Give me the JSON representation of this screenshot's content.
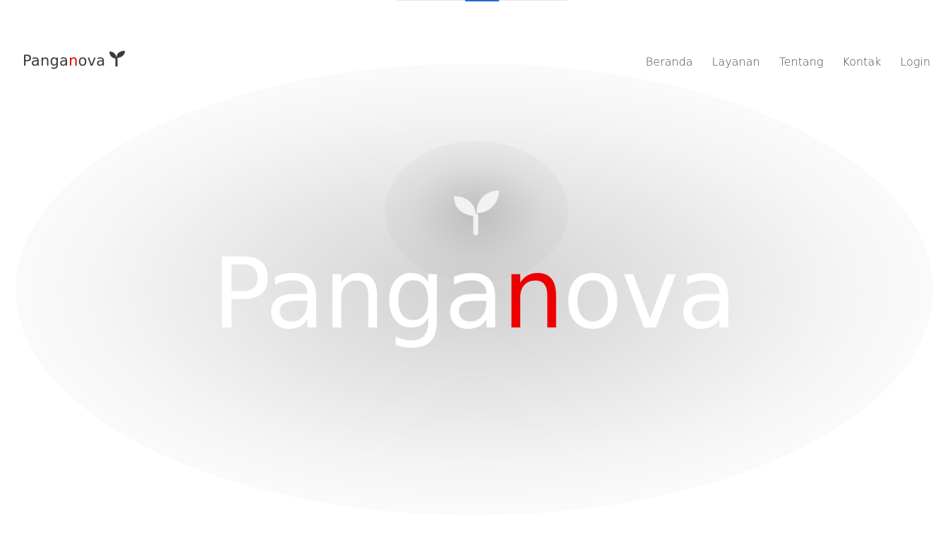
{
  "brand": {
    "name_prefix": "Panga",
    "name_accent": "n",
    "name_suffix": "ova",
    "icon": "sprout-icon"
  },
  "nav": {
    "items": [
      {
        "label": "Beranda"
      },
      {
        "label": "Layanan"
      },
      {
        "label": "Tentang"
      },
      {
        "label": "Kontak"
      },
      {
        "label": "Login"
      }
    ]
  },
  "hero": {
    "title_prefix": "Panga",
    "title_accent": "n",
    "title_suffix": "ova",
    "icon": "sprout-icon"
  },
  "colors": {
    "accent": "#e60000",
    "text": "#444444",
    "hero_text": "#ffffff",
    "scroll_thumb": "#1f6fd6"
  }
}
